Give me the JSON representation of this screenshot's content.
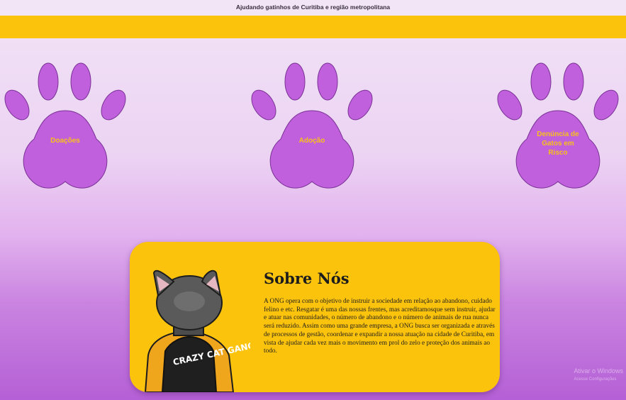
{
  "header": {
    "tagline": "Ajudando gatinhos de Curitiba e região metropolitana"
  },
  "paws": [
    {
      "label": "Doações"
    },
    {
      "label": "Adoção"
    },
    {
      "label": "Denúncia de Gatos em Risco"
    }
  ],
  "about": {
    "title": "Sobre Nós",
    "text": "A ONG opera com o objetivo de instruir a sociedade em relação ao abandono, cuidado felino e etc. Resgatar é uma das nossas frentes, mas acreditamosque sem instruir, ajudar e atuar nas comunidades, o número de abandono e o número de animais de rua nunca será reduzido. Assim como uma grande empresa, a ONG busca ser organizada e através de processos de gestão, coordenar e expandir a nossa atuação na cidade de Curitiba, em vista de ajudar cada vez mais o movimento em prol do zelo e proteção dos animais ao todo.",
    "image_text": "CRAZY CAT GANG"
  },
  "watermark": {
    "line1": "Ativar o Windows",
    "line2": "Acesse Configurações"
  },
  "colors": {
    "accent_yellow": "#fcc30d",
    "paw_purple": "#c060dc",
    "label_yellow": "#f7c01a"
  }
}
